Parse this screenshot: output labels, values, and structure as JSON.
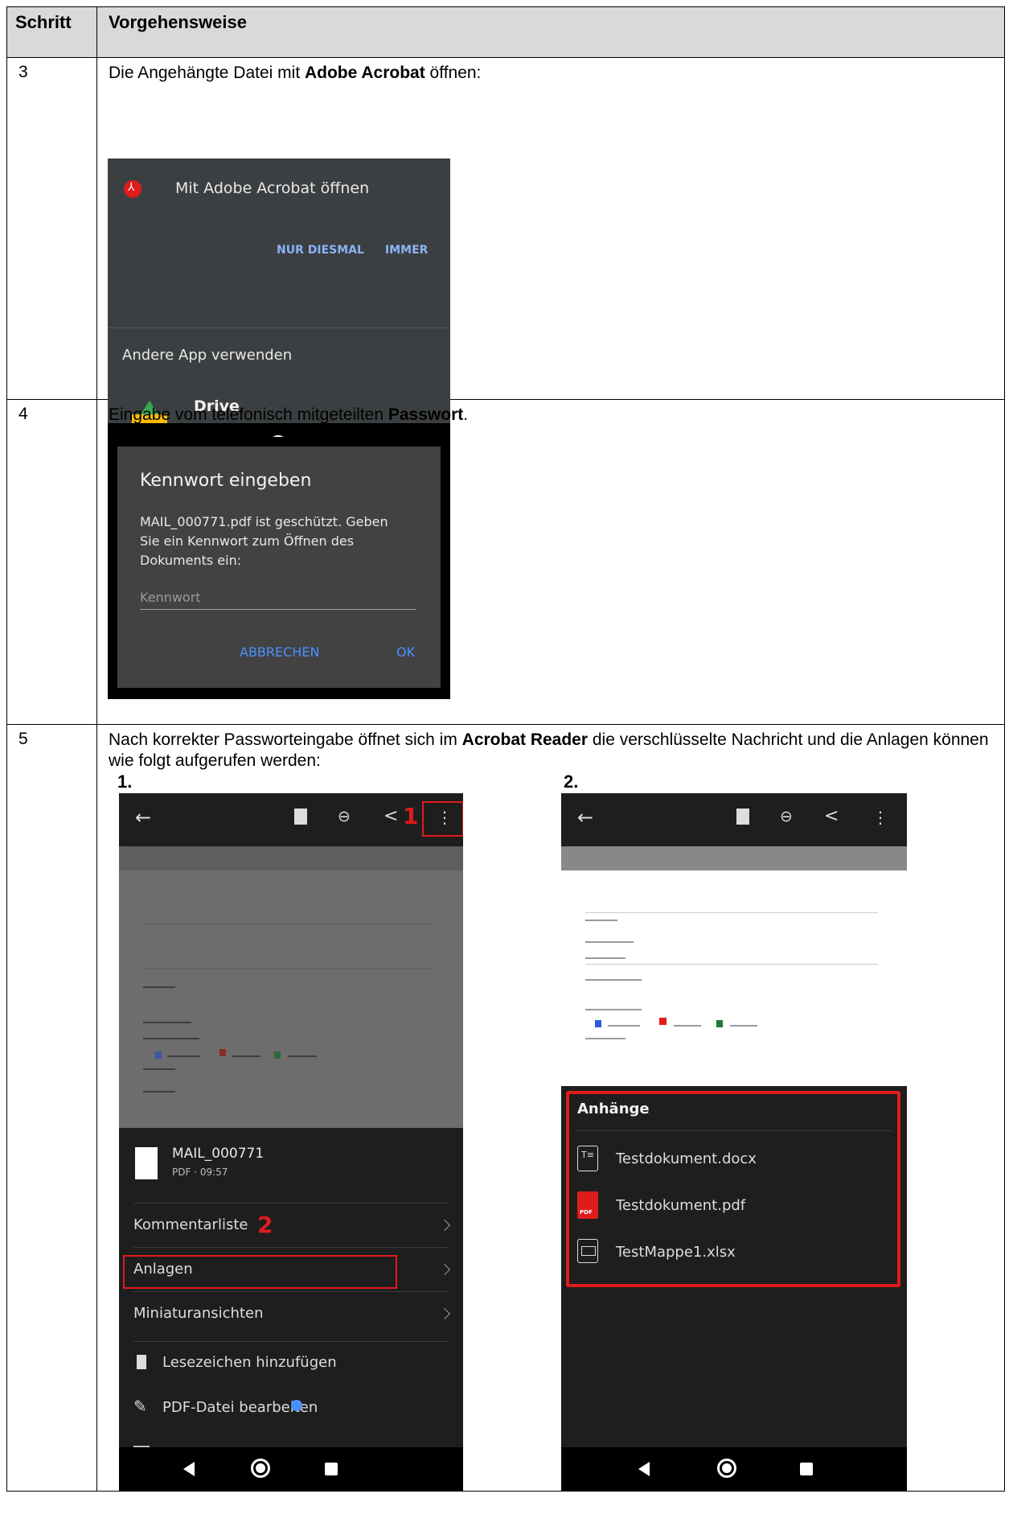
{
  "table": {
    "headers": [
      "Schritt",
      "Vorgehensweise"
    ],
    "rows": [
      {
        "step": "3",
        "text_pre": "Die Angehängte Datei mit ",
        "text_bold": "Adobe Acrobat",
        "text_post": " öffnen:"
      },
      {
        "step": "4",
        "text_pre": "Eingabe vom telefonisch mitgeteilten ",
        "text_bold": "Passwort",
        "text_post": "."
      },
      {
        "step": "5",
        "text_pre": "Nach korrekter Passworteingabe öffnet sich im ",
        "text_bold": "Acrobat Reader",
        "text_post": " die verschlüsselte Nachricht und die Anlagen können wie folgt aufgerufen werden:"
      }
    ]
  },
  "open_with": {
    "title": "Mit Adobe Acrobat öffnen",
    "btn_once": "NUR DIESMAL",
    "btn_always": "IMMER",
    "other_app": "Andere App verwenden",
    "drive": "Drive",
    "colors": {
      "bg": "#3c3f41",
      "accent": "#8ab4f8"
    }
  },
  "password_dialog": {
    "title": "Kennwort eingeben",
    "message": "MAIL_000771.pdf ist geschützt. Geben Sie ein Kennwort zum Öffnen des Dokuments ein:",
    "placeholder": "Kennwort",
    "cancel": "ABBRECHEN",
    "ok": "OK",
    "colors": {
      "bg": "#424242",
      "accent": "#4a90ff"
    }
  },
  "step5": {
    "label1": "1.",
    "label2": "2.",
    "marker1": "1",
    "marker2": "2",
    "file_name": "MAIL_000771",
    "file_meta": "PDF · 09:57",
    "menu": [
      "Kommentarliste",
      "Anlagen",
      "Miniaturansichten"
    ],
    "actions": [
      "Lesezeichen hinzufügen",
      "PDF-Datei bearbeiten"
    ],
    "attachments_title": "Anhänge",
    "attachments": [
      "Testdokument.docx",
      "Testdokument.pdf",
      "TestMappe1.xlsx"
    ],
    "colors": {
      "highlight": "#e01b1b",
      "pdf_red": "#e01b1b",
      "panel": "#1e1e1e"
    }
  }
}
